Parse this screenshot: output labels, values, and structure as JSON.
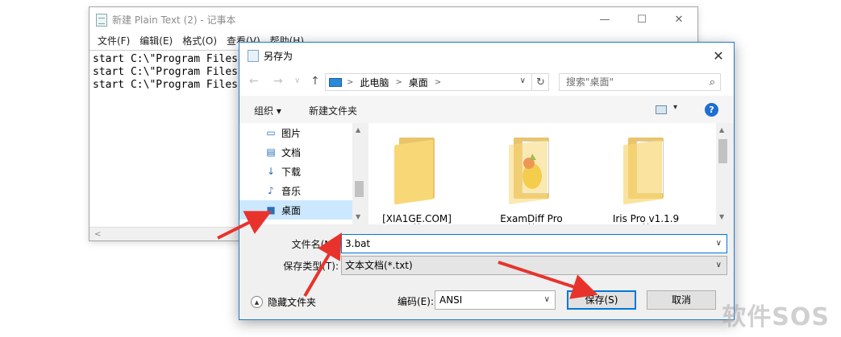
{
  "notepad": {
    "title": "新建 Plain Text (2) - 记事本",
    "controls": [
      "—",
      "☐",
      "✕"
    ],
    "menu": [
      "文件(F)",
      "编辑(E)",
      "格式(O)",
      "查看(V)",
      "帮助(H)"
    ],
    "lines": [
      "start C:\\\"Program Files",
      "start C:\\\"Program Files",
      "start C:\\\"Program Files"
    ],
    "hscroll_arrow": "<"
  },
  "dialog": {
    "title": "另存为",
    "close": "✕",
    "nav": {
      "back": "←",
      "forward": "→",
      "down": "∨",
      "up": "↑",
      "refresh": "↻"
    },
    "address": {
      "parts": [
        "此电脑",
        "桌面"
      ],
      "sep": ">",
      "dropdown": "∨"
    },
    "search": {
      "placeholder": "搜索\"桌面\"",
      "icon": "⌕"
    },
    "toolbar": {
      "organize": "组织 ▾",
      "new_folder": "新建文件夹",
      "view_dd": "▾",
      "help": "?"
    },
    "nav_pane": {
      "items": [
        {
          "label": "图片",
          "icon": "▭"
        },
        {
          "label": "文档",
          "icon": "▤"
        },
        {
          "label": "下载",
          "icon": "↓"
        },
        {
          "label": "音乐",
          "icon": "♪"
        },
        {
          "label": "桌面",
          "icon": "■"
        }
      ],
      "scroll_up": "▲",
      "scroll_down": "▼"
    },
    "files": [
      {
        "name": "[XIA1GE.COM]",
        "sub": "' '"
      },
      {
        "name": "ExamDiff Pro",
        "sub": "' '"
      },
      {
        "name": "Iris Pro v1.1.9",
        "sub": "' '"
      }
    ],
    "filename": {
      "label": "文件名(N):",
      "value": "3.bat",
      "caret": "∨"
    },
    "filetype": {
      "label": "保存类型(T):",
      "value": "文本文档(*.txt)",
      "caret": "∨"
    },
    "hide_folders": {
      "label": "隐藏文件夹",
      "icon": "▲"
    },
    "encoding": {
      "label": "编码(E):",
      "value": "ANSI",
      "caret": "∨"
    },
    "save": "保存(S)",
    "cancel": "取消"
  },
  "watermark": "软件SOS",
  "colors": {
    "accent": "#0078d7",
    "arrow": "#e8332c",
    "folder": "#f8d776"
  }
}
